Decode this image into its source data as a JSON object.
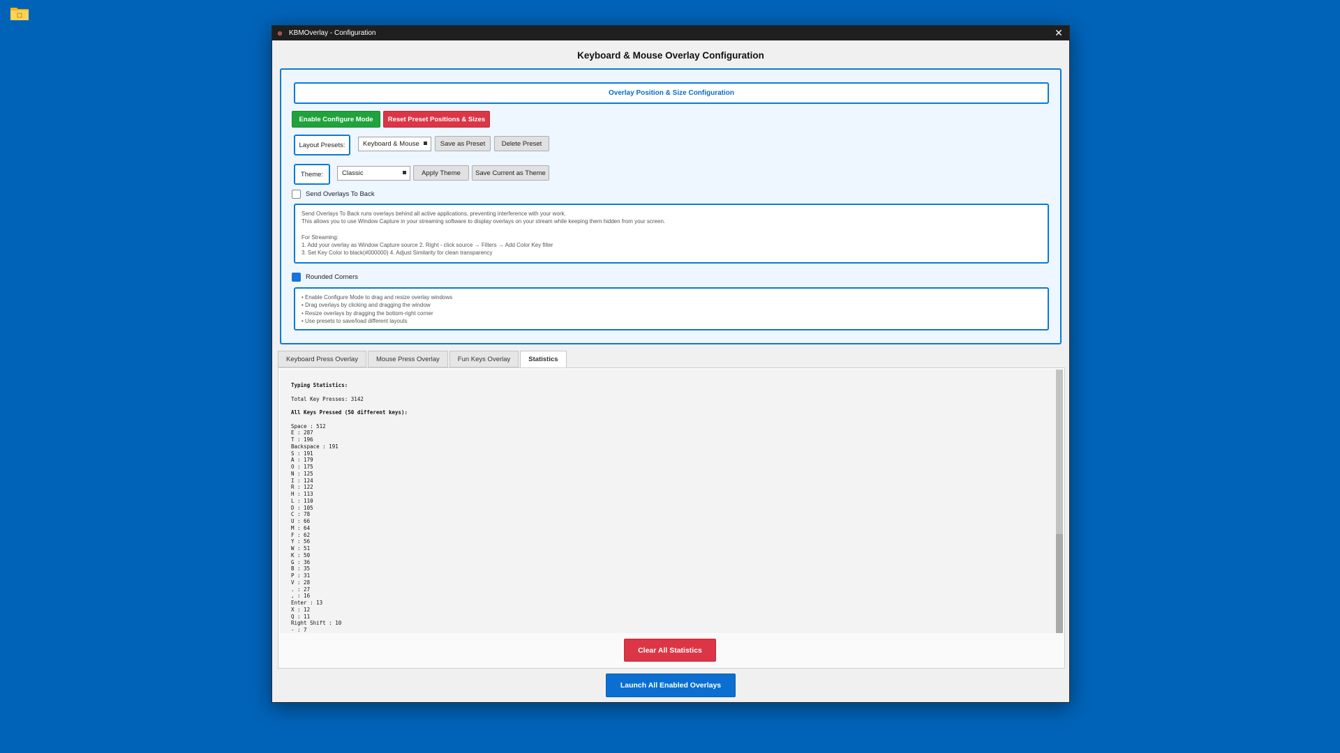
{
  "window": {
    "title": "KBMOverlay - Configuration",
    "close_glyph": "✕"
  },
  "main": {
    "title": "Keyboard & Mouse Overlay Configuration"
  },
  "config": {
    "section_header": "Overlay Position & Size Configuration",
    "enable_configure_label": "Enable Configure Mode",
    "reset_preset_label": "Reset Preset Positions & Sizes",
    "layout_presets_label": "Layout Presets:",
    "layout_preset_value": "Keyboard & Mouse",
    "save_as_preset_label": "Save as Preset",
    "delete_preset_label": "Delete Preset",
    "theme_label": "Theme:",
    "theme_value": "Classic",
    "apply_theme_label": "Apply Theme",
    "save_current_theme_label": "Save Current as Theme",
    "send_to_back_label": "Send Overlays To Back",
    "send_to_back_checked": false,
    "send_to_back_info": [
      "Send Overlays To Back runs overlays behind all active applications, preventing interference with your work.",
      "This allows you to use Window Capture in your streaming software to display overlays on your stream while keeping them hidden from your screen.",
      "",
      "For Streaming:",
      "1. Add your overlay as Window Capture source 2. Right - click source → Filters → Add Color Key filter",
      "3. Set Key Color to black(#000000) 4. Adjust Similarity for clean transparency"
    ],
    "rounded_corners_label": "Rounded Corners",
    "rounded_corners_checked": true,
    "tips": [
      "• Enable Configure Mode to drag and resize overlay windows",
      "• Drag overlays by clicking and dragging the window",
      "• Resize overlays by dragging the bottom-right corner",
      "• Use presets to save/load different layouts"
    ]
  },
  "tabs": [
    {
      "label": "Keyboard Press Overlay",
      "active": false
    },
    {
      "label": "Mouse Press Overlay",
      "active": false
    },
    {
      "label": "Fun Keys Overlay",
      "active": false
    },
    {
      "label": "Statistics",
      "active": true
    }
  ],
  "statistics": {
    "heading": "Typing Statistics:",
    "total_line": "Total Key Presses: 3142",
    "all_keys_heading": "All Keys Pressed (50 different keys):",
    "keys": [
      "Space : 512",
      "E : 287",
      "T : 196",
      "Backspace : 191",
      "S : 191",
      "A : 179",
      "O : 175",
      "N : 125",
      "I : 124",
      "R : 122",
      "H : 113",
      "L : 110",
      "D : 105",
      "C : 78",
      "U : 66",
      "M : 64",
      "F : 62",
      "Y : 56",
      "W : 51",
      "K : 50",
      "G : 36",
      "B : 35",
      "P : 31",
      "V : 28",
      ". : 27",
      ", : 16",
      "Enter : 13",
      "X : 12",
      "Q : 11",
      "Right Shift : 10",
      "- : 7"
    ],
    "clear_label": "Clear All Statistics"
  },
  "footer": {
    "launch_label": "Launch All Enabled Overlays"
  },
  "colors": {
    "desktop": "#0063b8",
    "accent_blue": "#0a7ad6",
    "green": "#21a33c",
    "red": "#dc3545"
  },
  "icons": {
    "desktop_icon": "folder-icon",
    "close": "close-icon",
    "combo_arrow": "dropdown-arrow-icon"
  }
}
